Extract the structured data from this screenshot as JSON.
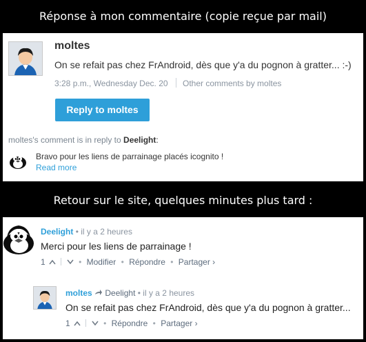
{
  "captions": {
    "top": "Réponse à mon commentaire (copie reçue par mail)",
    "bottom": "Retour sur le site, quelques minutes plus tard :"
  },
  "email": {
    "author": "moltes",
    "message": "On se refait pas chez FrAndroid, dès que y'a du pognon à gratter... :-)",
    "timestamp": "3:28 p.m., Wednesday Dec. 20",
    "other_comments": "Other comments by moltes",
    "reply_button": "Reply to moltes",
    "reply_context_prefix": "moltes's comment is in reply to",
    "reply_context_target": "Deelight",
    "reply_context_suffix": ":",
    "quoted_text": "Bravo pour les liens de parrainage placés icognito !",
    "read_more": "Read more"
  },
  "site": {
    "comment1": {
      "author": "Deelight",
      "time": "il y a 2 heures",
      "text": "Merci pour les liens de parrainage !",
      "votes": "1",
      "modify": "Modifier",
      "reply": "Répondre",
      "share": "Partager ›"
    },
    "comment2": {
      "author": "moltes",
      "reply_to": "Deelight",
      "time": "il y a 2 heures",
      "text": "On se refait pas chez FrAndroid, dès que y'a du pognon à gratter...",
      "votes": "1",
      "reply": "Répondre",
      "share": "Partager ›"
    },
    "separator": "•"
  },
  "colors": {
    "accent": "#2e9fd9",
    "button": "#2e9fd9"
  }
}
